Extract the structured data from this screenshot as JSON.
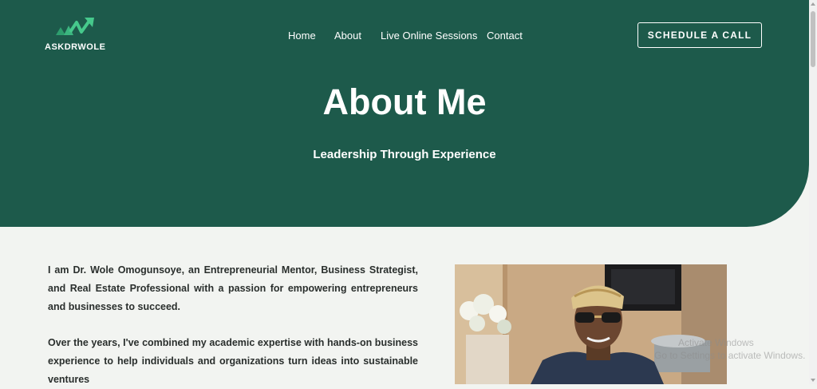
{
  "brand": {
    "name": "ASKDRWOLE",
    "accent_color": "#1d5a4b",
    "logo_icon": "chart-arrow-logo-icon"
  },
  "nav": {
    "items": [
      {
        "label": "Home"
      },
      {
        "label": "About"
      },
      {
        "label": "Live Online Sessions"
      },
      {
        "label": "Contact"
      }
    ]
  },
  "cta": {
    "label": "SCHEDULE A CALL"
  },
  "hero": {
    "title": "About Me",
    "subtitle": "Leadership Through Experience"
  },
  "bio": {
    "paragraph1": "I am Dr. Wole Omogunsoye, an Entrepreneurial Mentor, Business Strategist, and Real Estate Professional with a passion for empowering entrepreneurs and businesses to succeed.",
    "paragraph2": "Over the years, I've combined my academic expertise with hands-on business experience to help individuals and organizations turn ideas into sustainable ventures"
  },
  "photo": {
    "subject": "portrait-photo"
  },
  "watermark": {
    "line1": "Activate Windows",
    "line2": "Go to Settings to activate Windows."
  }
}
